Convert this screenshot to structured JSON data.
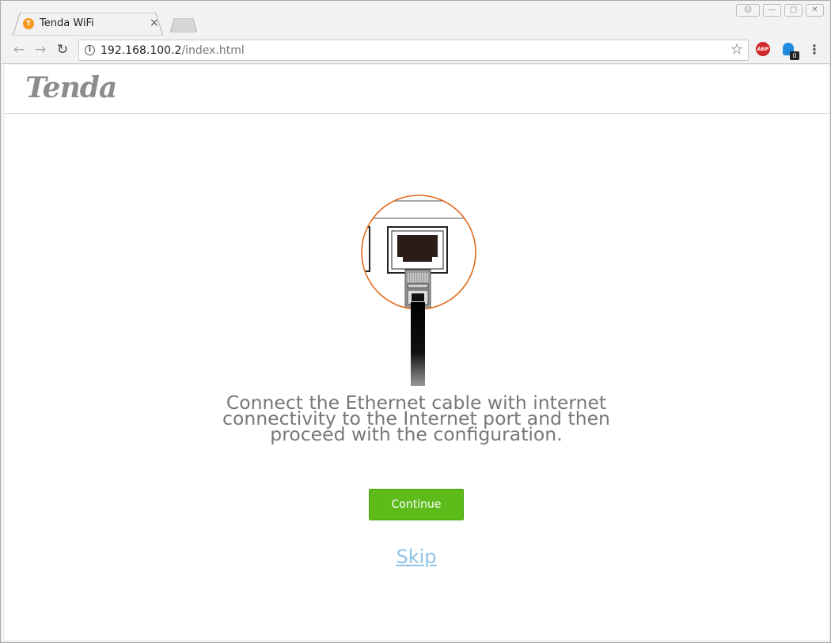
{
  "browser": {
    "tab": {
      "title": "Tenda WiFi",
      "favicon_icon": "tenda-favicon-icon",
      "close_glyph": "×"
    },
    "address": {
      "host": "192.168.100.2",
      "path": "/index.html"
    },
    "extensions": {
      "abp_label": "ABP",
      "ghost_badge": "0"
    }
  },
  "page": {
    "logo_text": "Tenda",
    "instruction": "Connect the Ethernet cable with internet connectivity to the Internet port and then proceed with the configuration.",
    "instruction_lines": [
      "Connect the Ethernet cable with internet",
      "connectivity to the Internet port and then",
      "proceed with the configuration."
    ],
    "continue_label": "Continue",
    "skip_label": "Skip"
  },
  "colors": {
    "accent_orange": "#e06a1a",
    "button_green": "#5dbb1a",
    "skip_link_blue": "#8ec3e8",
    "logo_gray": "#8c8c8c"
  }
}
